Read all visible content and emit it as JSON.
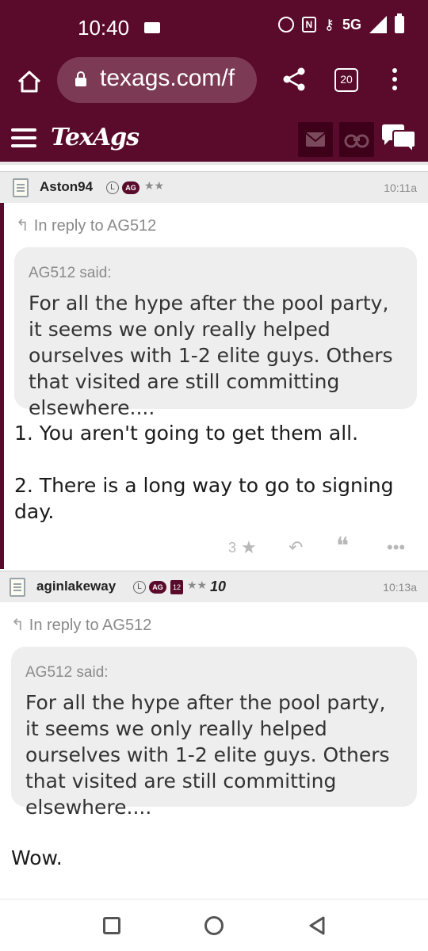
{
  "status": {
    "time": "10:40",
    "network": "5G"
  },
  "browser": {
    "url": "texags.com/f",
    "tab_count": "20"
  },
  "site": {
    "logo": "TexAgs"
  },
  "posts": [
    {
      "username": "Aston94",
      "badge_l": "L",
      "badge_ag": "AG",
      "stars": "★★",
      "time": "10:11a",
      "reply_to": "In reply to AG512",
      "quote_author": "AG512 said:",
      "quote_text": "For all the hype after the pool party, it seems we only really helped ourselves with 1-2 elite guys. Others that visited are still committing elsewhere....",
      "body_line1": "1. You aren't going to get them all.",
      "body_line2": "2. There is a long way to go to signing day.",
      "like_count": "3"
    },
    {
      "username": "aginlakeway",
      "badge_l": "L",
      "badge_ag": "AG",
      "badge_year": "12",
      "stars": "★★",
      "badge_10": "10",
      "time": "10:13a",
      "reply_to": "In reply to AG512",
      "quote_author": "AG512 said:",
      "quote_text": "For all the hype after the pool party, it seems we only really helped ourselves with 1-2 elite guys. Others that visited are still committing elsewhere....",
      "body": "Wow."
    }
  ],
  "icons": {
    "home": "home-icon",
    "lock": "lock-icon",
    "share": "share-icon",
    "menu": "overflow-menu-icon",
    "hamburger": "hamburger-icon",
    "mail": "mail-icon",
    "binoculars": "binoculars-icon",
    "chat": "chat-icon",
    "star": "star-icon",
    "reply": "reply-icon",
    "quote": "quote-icon",
    "more": "more-icon"
  },
  "colors": {
    "brand": "#5a0a2a",
    "quote_bg": "#eeeeee",
    "header_bg": "#ececec"
  }
}
